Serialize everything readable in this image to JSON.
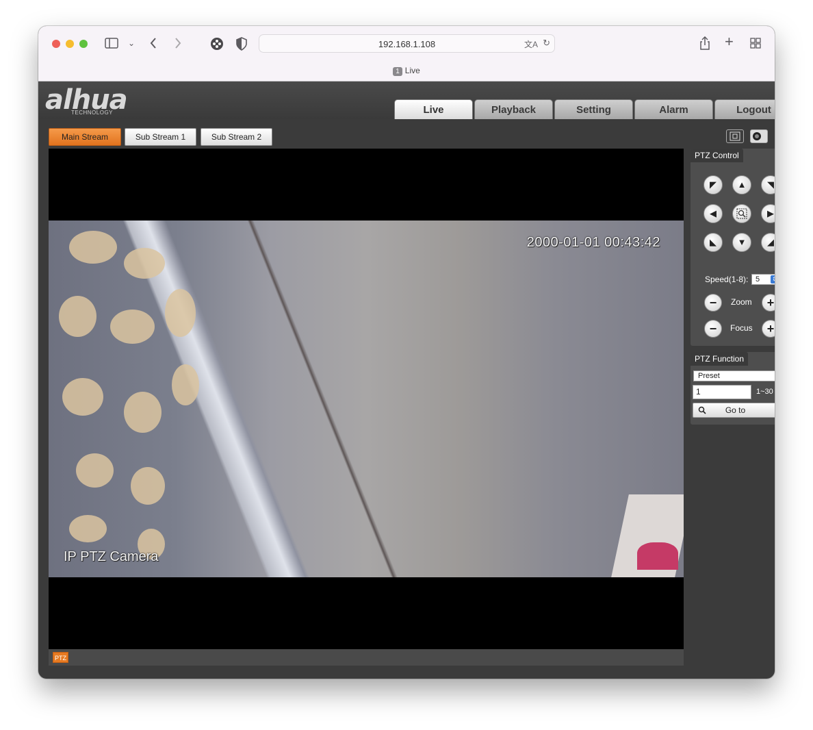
{
  "browser": {
    "url": "192.168.1.108",
    "tab": {
      "number": "1",
      "title": "Live"
    }
  },
  "header": {
    "logo_text": "alhua",
    "logo_sub": "TECHNOLOGY",
    "nav": [
      "Live",
      "Playback",
      "Setting",
      "Alarm",
      "Logout"
    ],
    "active_nav": "Live"
  },
  "streams": {
    "main": "Main Stream",
    "sub1": "Sub Stream 1",
    "sub2": "Sub Stream 2",
    "active": "Main Stream"
  },
  "video": {
    "timestamp": "2000-01-01 00:43:42",
    "camera_name": "IP PTZ Camera",
    "footer_badge": "PTZ"
  },
  "ptz_control": {
    "title": "PTZ Control",
    "speed_label": "Speed(1-8):",
    "speed_value": "5",
    "zoom_label": "Zoom",
    "focus_label": "Focus"
  },
  "ptz_function": {
    "title": "PTZ Function",
    "mode": "Preset",
    "preset_value": "1",
    "range": "1~30",
    "goto_label": "Go to"
  }
}
